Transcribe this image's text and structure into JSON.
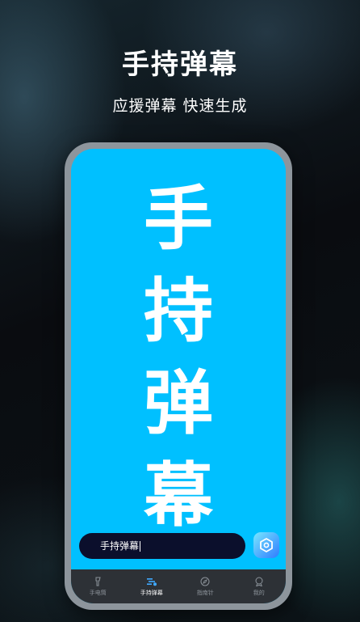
{
  "headline": "手持弹幕",
  "subline": "应援弹幕 快速生成",
  "danmu": {
    "chars": [
      "手",
      "持",
      "弹",
      "幕"
    ],
    "background_color": "#00c0ff",
    "text_color": "#ffffff"
  },
  "input": {
    "value": "手持弹幕"
  },
  "send_button": {
    "icon": "settings-hexagon-icon"
  },
  "tabs": [
    {
      "label": "手电筒",
      "icon": "flashlight-icon",
      "active": false
    },
    {
      "label": "手持弹幕",
      "icon": "danmu-icon",
      "active": true
    },
    {
      "label": "指南针",
      "icon": "compass-icon",
      "active": false
    },
    {
      "label": "我的",
      "icon": "profile-icon",
      "active": false
    }
  ]
}
